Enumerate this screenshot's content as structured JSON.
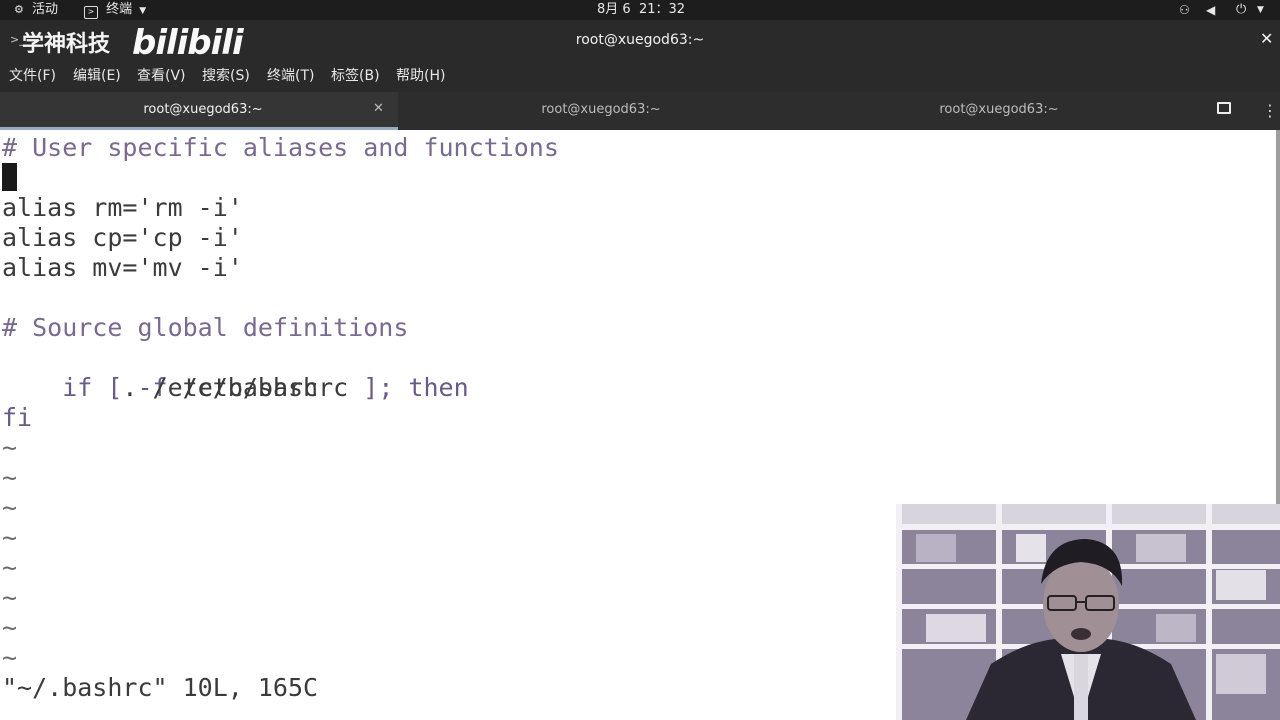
{
  "topbar": {
    "activities_label": "活动",
    "app_label": "终端",
    "clock": "8月 6  21：32"
  },
  "window": {
    "title": "root@xuegod63:~",
    "watermark_text": "学神科技",
    "watermark_logo": "bilibili"
  },
  "menu": {
    "file": "文件(F)",
    "edit": "编辑(E)",
    "view": "查看(V)",
    "search": "搜索(S)",
    "terminal": "终端(T)",
    "tabs": "标签(B)",
    "help": "帮助(H)"
  },
  "tabs": [
    {
      "label": "root@xuegod63:~",
      "active": true
    },
    {
      "label": "root@xuegod63:~",
      "active": false
    },
    {
      "label": "root@xuegod63:~",
      "active": false
    }
  ],
  "editor": {
    "line1": "# User specific aliases and functions",
    "line3": "alias rm='rm -i'",
    "line4": "alias cp='cp -i'",
    "line5": "alias mv='mv -i'",
    "line7": "# Source global definitions",
    "line8_a": "if [ -f ",
    "line8_b": "/etc/bashrc",
    "line8_c": " ]; then",
    "line9": "        . /etc/bashrc",
    "line10": "fi",
    "tilde": "~",
    "status": "\"~/.bashrc\" 10L, 165C"
  },
  "colors": {
    "comment": "#7a6a90",
    "text": "#3b3b3b",
    "chrome": "#2a2a2a"
  }
}
